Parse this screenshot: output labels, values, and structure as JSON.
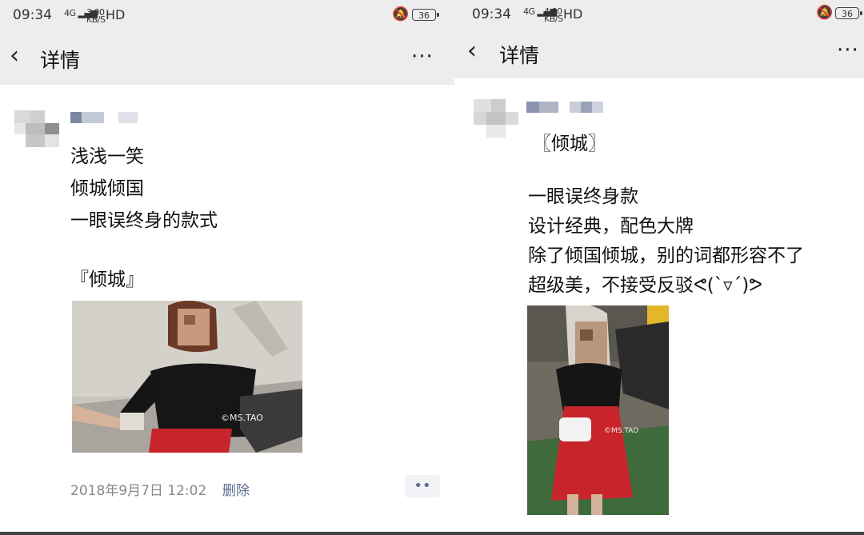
{
  "left": {
    "status": {
      "time": "09:34",
      "net": "4G",
      "speed_top": "3.00",
      "speed_unit": "KB/S",
      "hd": "HD",
      "battery": "36"
    },
    "nav": {
      "back_icon": "chevron-left",
      "title": "详情",
      "more_icon": "ellipsis"
    },
    "post": {
      "lines": [
        "浅浅一笑",
        "倾城倾国",
        "一眼误终身的款式",
        "『倾城』"
      ],
      "watermark": "©MS.TAO",
      "date": "2018年9月7日 12:02",
      "delete_label": "删除",
      "actions_icon": "••"
    }
  },
  "right": {
    "status": {
      "time": "09:34",
      "net": "4G",
      "speed_top": "4.00",
      "speed_unit": "KB/S",
      "hd": "HD",
      "battery": "36"
    },
    "nav": {
      "back_icon": "chevron-left",
      "title": "详情",
      "more_icon": "ellipsis"
    },
    "post": {
      "lines": [
        "〖倾城〗",
        "一眼误终身款",
        "设计经典，配色大牌",
        "除了倾国倾城，别的词都形容不了",
        "超级美，不接受反驳ᕙ(`▿´)ᕗ"
      ],
      "watermark": "©MS.TAO"
    }
  },
  "colors": {
    "bar_bg": "#ededed",
    "link": "#5b6b91",
    "muted": "#888888",
    "skirt": "#c8242b"
  }
}
